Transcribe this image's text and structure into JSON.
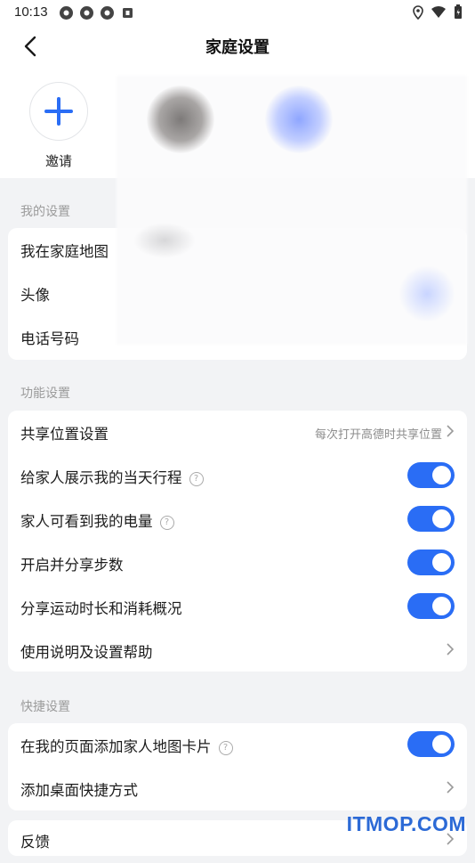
{
  "status_bar": {
    "time": "10:13"
  },
  "header": {
    "title": "家庭设置"
  },
  "members": {
    "invite_label": "邀请"
  },
  "my_settings": {
    "section_title": "我的设置",
    "items": [
      {
        "label": "我在家庭地图"
      },
      {
        "label": "头像"
      },
      {
        "label": "电话号码"
      }
    ]
  },
  "function_settings": {
    "section_title": "功能设置",
    "share_location": {
      "label": "共享位置设置",
      "value": "每次打开高德时共享位置"
    },
    "toggles": [
      {
        "label": "给家人展示我的当天行程",
        "help": true,
        "on": true
      },
      {
        "label": "家人可看到我的电量",
        "help": true,
        "on": true
      },
      {
        "label": "开启并分享步数",
        "help": false,
        "on": true
      },
      {
        "label": "分享运动时长和消耗概况",
        "help": false,
        "on": true
      }
    ],
    "help_link": {
      "label": "使用说明及设置帮助"
    }
  },
  "quick_settings": {
    "section_title": "快捷设置",
    "add_card": {
      "label": "在我的页面添加家人地图卡片",
      "on": true
    },
    "add_shortcut": {
      "label": "添加桌面快捷方式"
    }
  },
  "feedback": {
    "label": "反馈"
  },
  "watermark": {
    "text": "ITMOP.COM"
  },
  "colors": {
    "accent": "#2a6df5",
    "background": "#f2f3f5",
    "section_text": "#9b9b9b"
  }
}
